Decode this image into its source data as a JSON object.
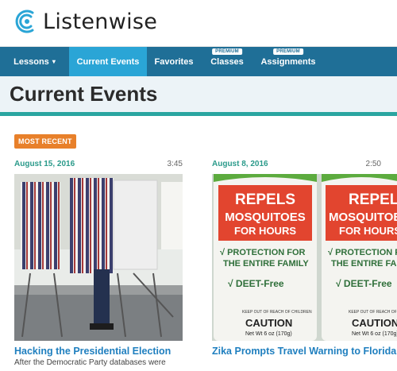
{
  "brand": {
    "name": "Listenwise"
  },
  "nav": {
    "items": [
      {
        "label": "Lessons",
        "has_caret": true
      },
      {
        "label": "Current Events",
        "active": true
      },
      {
        "label": "Favorites"
      },
      {
        "label": "Classes",
        "tag": "PREMIUM"
      },
      {
        "label": "Assignments",
        "tag": "PREMIUM"
      }
    ],
    "caret": "▾"
  },
  "page": {
    "title": "Current Events"
  },
  "filter_badge": "MOST RECENT",
  "cards": [
    {
      "date": "August 15, 2016",
      "duration": "3:45",
      "title": "Hacking the Presidential Election",
      "excerpt": "After the Democratic Party databases were"
    },
    {
      "date": "August 8, 2016",
      "duration": "2:50",
      "title": "Zika Prompts Travel Warning to Florida",
      "can_text": {
        "line1": "REPELS",
        "line2": "MOSQUITOES",
        "line3": "FOR HOURS",
        "line4": "√ PROTECTION FOR",
        "line5": "THE ENTIRE FAMILY",
        "line6": "√ DEET-Free",
        "line7": "KEEP OUT OF REACH OF CHILDREN",
        "line8": "CAUTION",
        "line9": "Net Wt 6 oz (170g)"
      }
    }
  ],
  "colors": {
    "nav_bg": "#1f6f97",
    "nav_active": "#2aa5d6",
    "accent_teal": "#2aa5a0",
    "badge": "#e8802a",
    "link": "#1f7fbf"
  }
}
